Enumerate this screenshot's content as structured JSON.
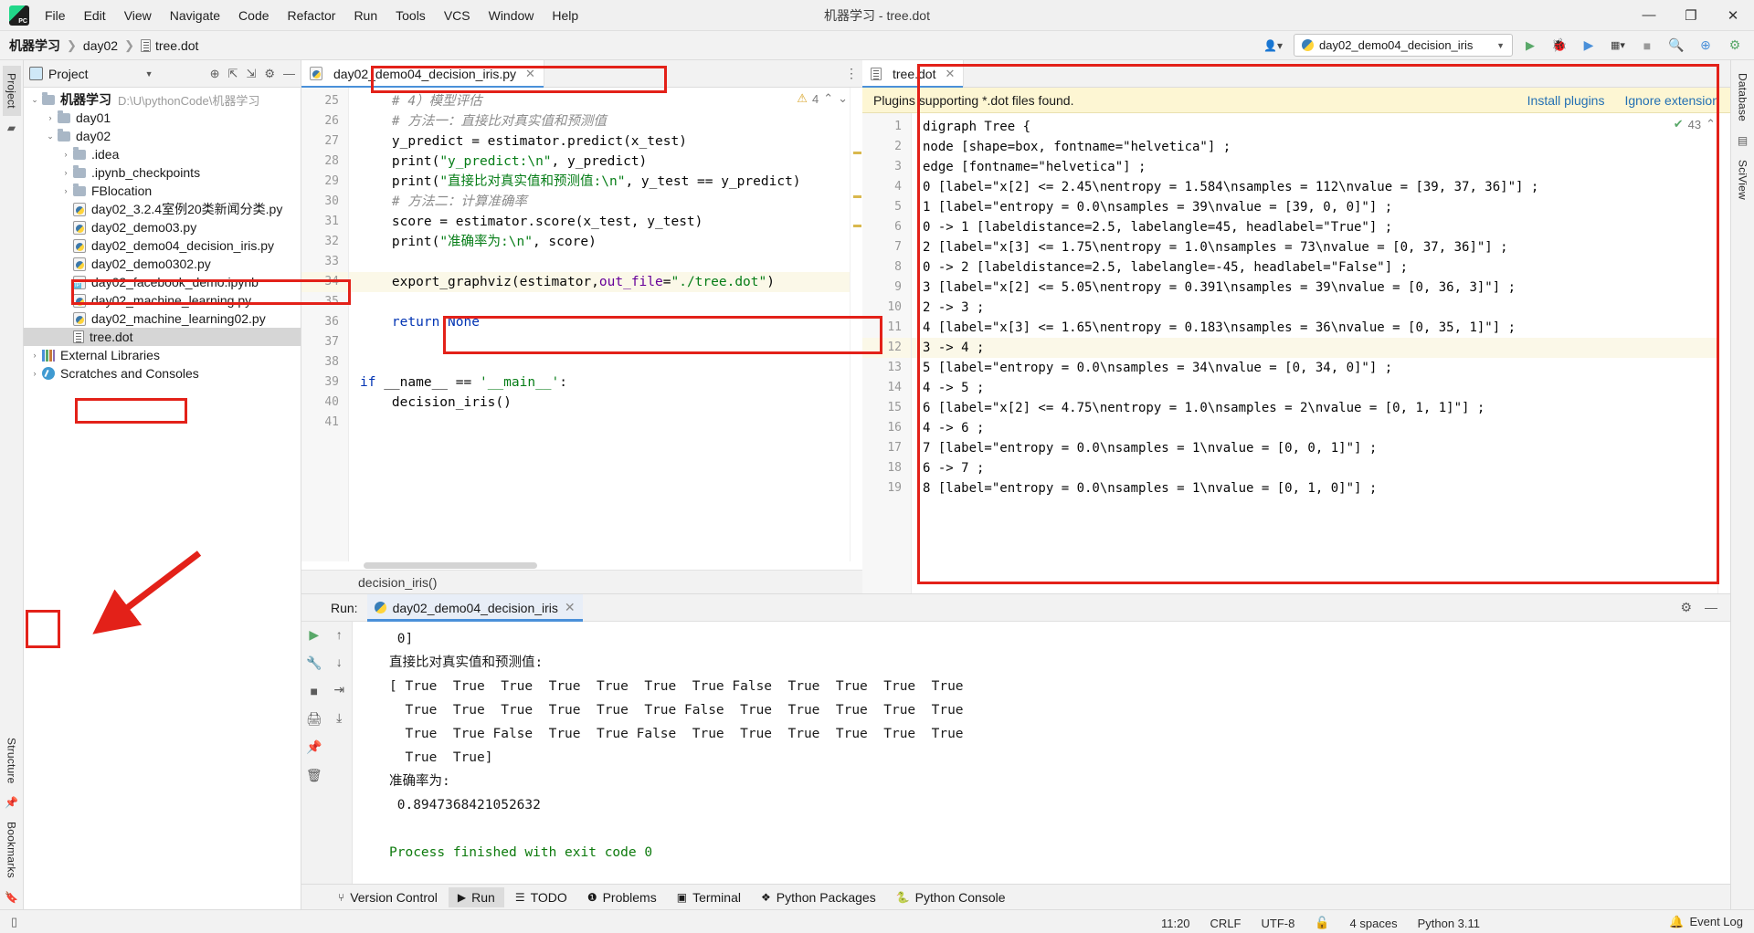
{
  "titlebar": {
    "project_icon": "pycharm-logo",
    "menu": [
      "File",
      "Edit",
      "View",
      "Navigate",
      "Code",
      "Refactor",
      "Run",
      "Tools",
      "VCS",
      "Window",
      "Help"
    ],
    "window_title": "机器学习 - tree.dot",
    "minimize": "—",
    "maximize": "▢",
    "close": "✕"
  },
  "navbar": {
    "crumbs": [
      "机器学习",
      "day02",
      "tree.dot"
    ],
    "separator": "›",
    "run_config": "day02_demo04_decision_iris",
    "icons": {
      "run": "▶",
      "debug": "debug-icon",
      "coverage": "coverage-icon",
      "profile": "profile-icon",
      "stop": "■",
      "search": "🔍",
      "update": "update-icon",
      "settings": "settings-icon"
    }
  },
  "left_rail": {
    "project": "Project",
    "structure": "Structure",
    "bookmarks": "Bookmarks"
  },
  "right_rail": {
    "database": "Database",
    "sciview": "SciView"
  },
  "project_panel": {
    "title": "Project",
    "tree": [
      {
        "indent": 0,
        "arrow": "v",
        "icon": "folder",
        "label": "机器学习",
        "bold": true,
        "path": "D:\\U\\pythonCode\\机器学习"
      },
      {
        "indent": 1,
        "arrow": ">",
        "icon": "folder",
        "label": "day01",
        "bold": false,
        "path": ""
      },
      {
        "indent": 1,
        "arrow": "v",
        "icon": "folder",
        "label": "day02",
        "bold": false,
        "path": ""
      },
      {
        "indent": 2,
        "arrow": ">",
        "icon": "folder",
        "label": ".idea",
        "bold": false,
        "path": ""
      },
      {
        "indent": 2,
        "arrow": ">",
        "icon": "folder",
        "label": ".ipynb_checkpoints",
        "bold": false,
        "path": ""
      },
      {
        "indent": 2,
        "arrow": ">",
        "icon": "folder",
        "label": "FBlocation",
        "bold": false,
        "path": ""
      },
      {
        "indent": 2,
        "arrow": "",
        "icon": "py",
        "label": "day02_3.2.4室例20类新闻分类.py",
        "bold": false,
        "path": ""
      },
      {
        "indent": 2,
        "arrow": "",
        "icon": "py",
        "label": "day02_demo03.py",
        "bold": false,
        "path": ""
      },
      {
        "indent": 2,
        "arrow": "",
        "icon": "py",
        "label": "day02_demo04_decision_iris.py",
        "bold": false,
        "path": "",
        "highlight": true
      },
      {
        "indent": 2,
        "arrow": "",
        "icon": "py",
        "label": "day02_demo0302.py",
        "bold": false,
        "path": ""
      },
      {
        "indent": 2,
        "arrow": "",
        "icon": "ipynb",
        "label": "day02_facebook_demo.ipynb",
        "bold": false,
        "path": ""
      },
      {
        "indent": 2,
        "arrow": "",
        "icon": "py",
        "label": "day02_machine_learning.py",
        "bold": false,
        "path": ""
      },
      {
        "indent": 2,
        "arrow": "",
        "icon": "py",
        "label": "day02_machine_learning02.py",
        "bold": false,
        "path": ""
      },
      {
        "indent": 2,
        "arrow": "",
        "icon": "dot",
        "label": "tree.dot",
        "bold": false,
        "path": "",
        "selected": true,
        "highlight": true
      },
      {
        "indent": 0,
        "arrow": ">",
        "icon": "lib",
        "label": "External Libraries",
        "bold": false,
        "path": ""
      },
      {
        "indent": 0,
        "arrow": ">",
        "icon": "scratch",
        "label": "Scratches and Consoles",
        "bold": false,
        "path": ""
      }
    ]
  },
  "editor_left": {
    "tab": "day02_demo04_decision_iris.py",
    "tab_close": "✕",
    "warning_count": "4",
    "warning_icon": "warning-triangle",
    "lines": [
      {
        "n": "25",
        "segs": [
          {
            "t": "    # 4）模型评估",
            "c": "cmt"
          }
        ]
      },
      {
        "n": "26",
        "segs": [
          {
            "t": "    # 方法一：直接比对真实值和预测值",
            "c": "cmt"
          }
        ]
      },
      {
        "n": "27",
        "segs": [
          {
            "t": "    y_predict = estimator.predict(x_test)",
            "c": "plain"
          }
        ]
      },
      {
        "n": "28",
        "segs": [
          {
            "t": "    print(",
            "c": "plain"
          },
          {
            "t": "\"y_predict:\\n\"",
            "c": "str"
          },
          {
            "t": ", y_predict)",
            "c": "plain"
          }
        ]
      },
      {
        "n": "29",
        "segs": [
          {
            "t": "    print(",
            "c": "plain"
          },
          {
            "t": "\"直接比对真实值和预测值:\\n\"",
            "c": "str"
          },
          {
            "t": ", y_test == y_predict)",
            "c": "plain"
          }
        ]
      },
      {
        "n": "30",
        "segs": [
          {
            "t": "    # 方法二：计算准确率",
            "c": "cmt"
          }
        ]
      },
      {
        "n": "31",
        "segs": [
          {
            "t": "    score = estimator.score(x_test, y_test)",
            "c": "plain"
          }
        ]
      },
      {
        "n": "32",
        "segs": [
          {
            "t": "    print(",
            "c": "plain"
          },
          {
            "t": "\"准确率为:\\n\"",
            "c": "str"
          },
          {
            "t": ", score)",
            "c": "plain"
          }
        ]
      },
      {
        "n": "33",
        "segs": [
          {
            "t": "",
            "c": "plain"
          }
        ]
      },
      {
        "n": "34",
        "highlight": true,
        "segs": [
          {
            "t": "    export_graphviz(estimator,",
            "c": "plain"
          },
          {
            "t": "out_file",
            "c": "param"
          },
          {
            "t": "=",
            "c": "plain"
          },
          {
            "t": "\"./tree.dot\"",
            "c": "str"
          },
          {
            "t": ")",
            "c": "plain"
          }
        ]
      },
      {
        "n": "35",
        "segs": [
          {
            "t": "",
            "c": "plain"
          }
        ]
      },
      {
        "n": "36",
        "segs": [
          {
            "t": "    ",
            "c": "plain"
          },
          {
            "t": "return",
            "c": "kw"
          },
          {
            "t": " ",
            "c": "plain"
          },
          {
            "t": "None",
            "c": "kw"
          }
        ]
      },
      {
        "n": "37",
        "segs": [
          {
            "t": "",
            "c": "plain"
          }
        ]
      },
      {
        "n": "38",
        "segs": [
          {
            "t": "",
            "c": "plain"
          }
        ]
      },
      {
        "n": "39",
        "segs": [
          {
            "t": "",
            "c": "plain"
          },
          {
            "t": "if",
            "c": "kw"
          },
          {
            "t": " __name__ == ",
            "c": "plain"
          },
          {
            "t": "'__main__'",
            "c": "str"
          },
          {
            "t": ":",
            "c": "plain"
          }
        ]
      },
      {
        "n": "40",
        "segs": [
          {
            "t": "    decision_iris()",
            "c": "plain"
          }
        ]
      },
      {
        "n": "41",
        "segs": [
          {
            "t": "",
            "c": "plain"
          }
        ]
      }
    ],
    "breadcrumb_footer": "decision_iris()"
  },
  "editor_right": {
    "tab": "tree.dot",
    "tab_close": "✕",
    "plugin_notice": "Plugins supporting *.dot files found.",
    "install_link": "Install plugins",
    "ignore_link": "Ignore extension",
    "inspection_count": "43",
    "inspection_icon": "inspection-ok",
    "lines": [
      {
        "n": "1",
        "text": "digraph Tree {"
      },
      {
        "n": "2",
        "text": "node [shape=box, fontname=\"helvetica\"] ;"
      },
      {
        "n": "3",
        "text": "edge [fontname=\"helvetica\"] ;"
      },
      {
        "n": "4",
        "text": "0 [label=\"x[2] <= 2.45\\nentropy = 1.584\\nsamples = 112\\nvalue = [39, 37, 36]\"] ;"
      },
      {
        "n": "5",
        "text": "1 [label=\"entropy = 0.0\\nsamples = 39\\nvalue = [39, 0, 0]\"] ;"
      },
      {
        "n": "6",
        "text": "0 -> 1 [labeldistance=2.5, labelangle=45, headlabel=\"True\"] ;"
      },
      {
        "n": "7",
        "text": "2 [label=\"x[3] <= 1.75\\nentropy = 1.0\\nsamples = 73\\nvalue = [0, 37, 36]\"] ;"
      },
      {
        "n": "8",
        "text": "0 -> 2 [labeldistance=2.5, labelangle=-45, headlabel=\"False\"] ;"
      },
      {
        "n": "9",
        "text": "3 [label=\"x[2] <= 5.05\\nentropy = 0.391\\nsamples = 39\\nvalue = [0, 36, 3]\"] ;"
      },
      {
        "n": "10",
        "text": "2 -> 3 ;"
      },
      {
        "n": "11",
        "text": "4 [label=\"x[3] <= 1.65\\nentropy = 0.183\\nsamples = 36\\nvalue = [0, 35, 1]\"] ;"
      },
      {
        "n": "12",
        "text": "3 -> 4 ;",
        "highlight": true
      },
      {
        "n": "13",
        "text": "5 [label=\"entropy = 0.0\\nsamples = 34\\nvalue = [0, 34, 0]\"] ;"
      },
      {
        "n": "14",
        "text": "4 -> 5 ;"
      },
      {
        "n": "15",
        "text": "6 [label=\"x[2] <= 4.75\\nentropy = 1.0\\nsamples = 2\\nvalue = [0, 1, 1]\"] ;"
      },
      {
        "n": "16",
        "text": "4 -> 6 ;"
      },
      {
        "n": "17",
        "text": "7 [label=\"entropy = 0.0\\nsamples = 1\\nvalue = [0, 0, 1]\"] ;"
      },
      {
        "n": "18",
        "text": "6 -> 7 ;"
      },
      {
        "n": "19",
        "text": "8 [label=\"entropy = 0.0\\nsamples = 1\\nvalue = [0, 1, 0]\"] ;"
      }
    ]
  },
  "run_panel": {
    "label": "Run:",
    "tab": "day02_demo04_decision_iris",
    "tab_close": "✕",
    "toolbar_icons": {
      "rerun": "▶",
      "wrench": "wrench-icon",
      "stop": "■",
      "up": "↑",
      "down": "↓",
      "soft_wrap": "soft-wrap-icon",
      "scroll_end": "scroll-to-end-icon",
      "print": "print-icon",
      "pin": "pin-icon",
      "trash": "trash-icon"
    },
    "settings_icon": "gear-icon",
    "minimize_icon": "minimize-icon",
    "console_lines": [
      {
        "text": " 0]",
        "cls": ""
      },
      {
        "text": "直接比对真实值和预测值:",
        "cls": ""
      },
      {
        "text": "[ True  True  True  True  True  True  True False  True  True  True  True",
        "cls": ""
      },
      {
        "text": "  True  True  True  True  True  True False  True  True  True  True  True",
        "cls": ""
      },
      {
        "text": "  True  True False  True  True False  True  True  True  True  True  True",
        "cls": ""
      },
      {
        "text": "  True  True]",
        "cls": ""
      },
      {
        "text": "准确率为:",
        "cls": ""
      },
      {
        "text": " 0.8947368421052632",
        "cls": ""
      },
      {
        "text": "",
        "cls": ""
      },
      {
        "text": "Process finished with exit code 0",
        "cls": "ok"
      }
    ]
  },
  "bottom_toolbar": [
    {
      "icon": "version-control-icon",
      "label": "Version Control",
      "active": false
    },
    {
      "icon": "run-icon",
      "label": "Run",
      "active": true
    },
    {
      "icon": "todo-icon",
      "label": "TODO",
      "active": false
    },
    {
      "icon": "problems-icon",
      "label": "Problems",
      "active": false
    },
    {
      "icon": "terminal-icon",
      "label": "Terminal",
      "active": false
    },
    {
      "icon": "python-packages-icon",
      "label": "Python Packages",
      "active": false
    },
    {
      "icon": "python-console-icon",
      "label": "Python Console",
      "active": false
    }
  ],
  "statusbar": {
    "time": "11:20",
    "line_sep": "CRLF",
    "encoding": "UTF-8",
    "read_only_icon": "lock-icon",
    "indent": "4 spaces",
    "interpreter": "Python 3.11",
    "event_log": "Event Log",
    "event_log_icon": "bell-icon"
  }
}
